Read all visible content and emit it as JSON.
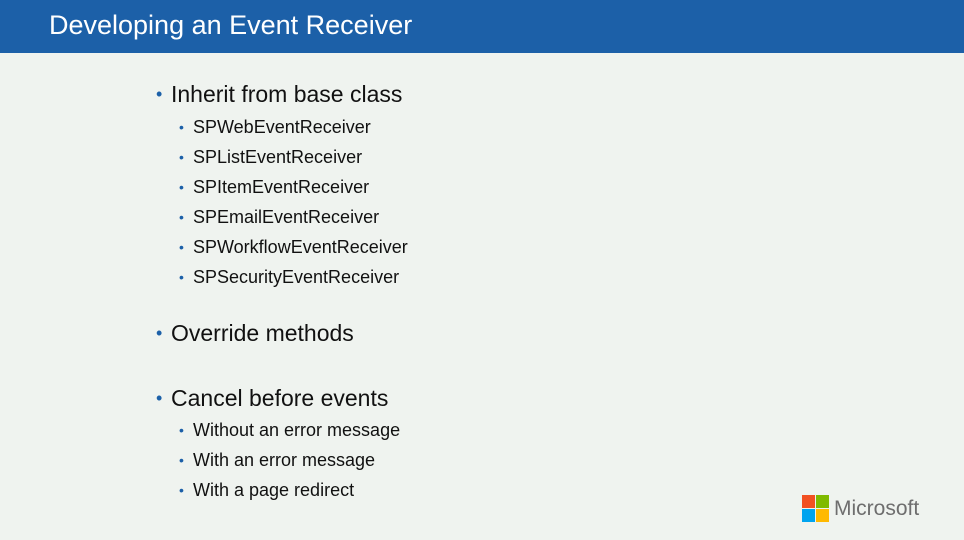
{
  "slide": {
    "title": "Developing an Event Receiver",
    "bullets": [
      {
        "text": "Inherit from base class",
        "children": [
          "SPWebEventReceiver",
          "SPListEventReceiver",
          "SPItemEventReceiver",
          "SPEmailEventReceiver",
          "SPWorkflowEventReceiver",
          "SPSecurityEventReceiver"
        ]
      },
      {
        "text": "Override methods",
        "children": []
      },
      {
        "text": "Cancel before events",
        "children": [
          "Without an error message",
          "With an error message",
          "With a page redirect"
        ]
      }
    ],
    "bullet_glyph": "•"
  },
  "logo": {
    "text": "Microsoft",
    "colors": {
      "red": "#f25022",
      "green": "#7fba00",
      "blue": "#00a4ef",
      "yellow": "#ffb900"
    }
  },
  "theme": {
    "title_bar": "#1c60a8",
    "background": "#eff3ef",
    "bullet": "#1c60a8"
  }
}
